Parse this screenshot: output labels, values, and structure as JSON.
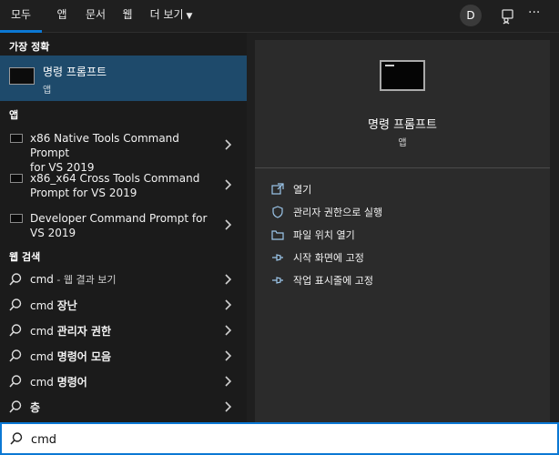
{
  "tabs": [
    {
      "label": "모두",
      "active": true
    },
    {
      "label": "앱",
      "active": false
    },
    {
      "label": "문서",
      "active": false
    },
    {
      "label": "웹",
      "active": false
    },
    {
      "label": "더 보기",
      "active": false
    }
  ],
  "header": {
    "avatar_initial": "D",
    "more_label": "···"
  },
  "left": {
    "best_match_label": "가장 정확",
    "best_match": {
      "title": "명령 프롬프트",
      "subtitle": "앱"
    },
    "apps_label": "앱",
    "apps": [
      {
        "line1": "x86 Native Tools Command Prompt",
        "line2": "for VS 2019"
      },
      {
        "line1": "x86_x64 Cross Tools Command",
        "line2": "Prompt for VS 2019"
      },
      {
        "line1": "Developer Command Prompt for",
        "line2": "VS 2019"
      }
    ],
    "web_label": "웹 검색",
    "web_results": [
      {
        "prefix": "cmd",
        "bold": "",
        "muted": " - 웹 결과 보기"
      },
      {
        "prefix": "cmd ",
        "bold": "장난",
        "muted": ""
      },
      {
        "prefix": "cmd ",
        "bold": "관리자 권한",
        "muted": ""
      },
      {
        "prefix": "cmd ",
        "bold": "명령어 모음",
        "muted": ""
      },
      {
        "prefix": "cmd ",
        "bold": "명령어",
        "muted": ""
      },
      {
        "prefix": "",
        "bold": "층",
        "muted": ""
      }
    ]
  },
  "right": {
    "title": "명령 프롬프트",
    "subtitle": "앱",
    "actions": [
      {
        "label": "열기",
        "icon": "open-icon"
      },
      {
        "label": "관리자 권한으로 실행",
        "icon": "shield-icon"
      },
      {
        "label": "파일 위치 열기",
        "icon": "folder-icon"
      },
      {
        "label": "시작 화면에 고정",
        "icon": "pin-icon"
      },
      {
        "label": "작업 표시줄에 고정",
        "icon": "pin-icon"
      }
    ]
  },
  "search": {
    "value": "cmd"
  },
  "colors": {
    "accent": "#0b78d4",
    "selected": "#1e4a6b",
    "panel": "#2b2b2b"
  }
}
